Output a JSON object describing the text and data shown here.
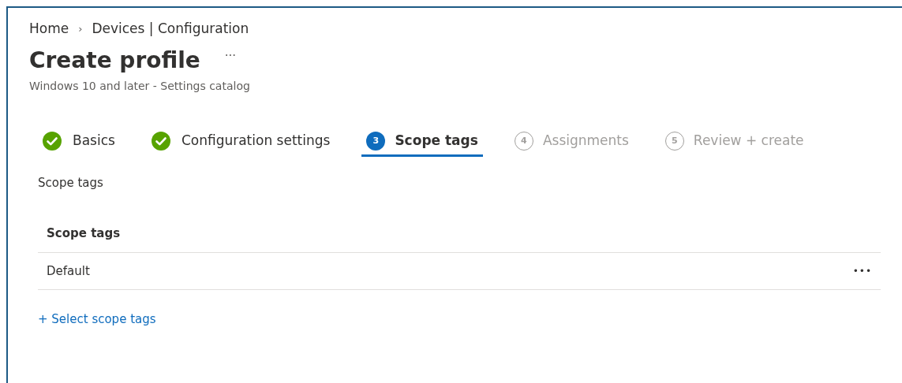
{
  "breadcrumb": [
    {
      "label": "Home"
    },
    {
      "label": "Devices | Configuration"
    }
  ],
  "breadcrumb_separator": "›",
  "title": "Create profile",
  "title_menu": "···",
  "subtitle": "Windows 10 and later - Settings catalog",
  "steps": [
    {
      "kind": "check",
      "label": "Basics",
      "disabled": false,
      "selected": false
    },
    {
      "kind": "check",
      "label": "Configuration settings",
      "disabled": false,
      "selected": false
    },
    {
      "kind": "number",
      "number": "3",
      "label": "Scope tags",
      "disabled": false,
      "selected": true
    },
    {
      "kind": "number",
      "number": "4",
      "label": "Assignments",
      "disabled": true,
      "selected": false
    },
    {
      "kind": "number",
      "number": "5",
      "label": "Review + create",
      "disabled": true,
      "selected": false
    }
  ],
  "section_label": "Scope tags",
  "table": {
    "columns": [
      "Scope tags"
    ],
    "rows": [
      {
        "cells": [
          "Default"
        ],
        "menu": "•••"
      }
    ]
  },
  "add_link": "+ Select scope tags"
}
